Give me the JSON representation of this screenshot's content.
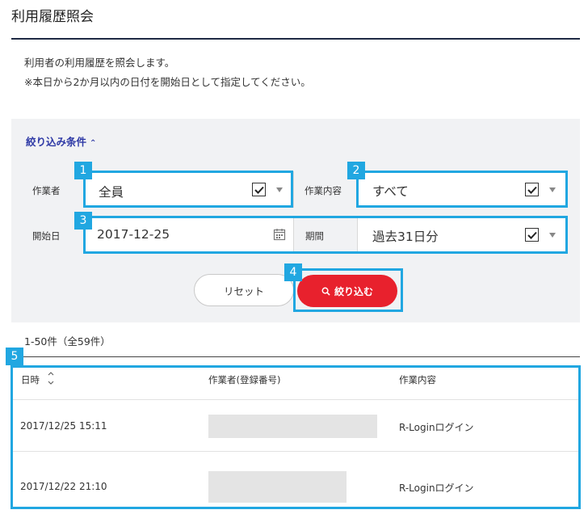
{
  "page": {
    "title": "利用履歴照会",
    "description_line1": "利用者の利用履歴を照会します。",
    "description_line2": "※本日から2か月以内の日付を開始日として指定してください。"
  },
  "filter": {
    "toggle_label": "絞り込み条件",
    "toggle_icon": "chevron-up-icon",
    "worker_label": "作業者",
    "worker_value": "全員",
    "work_content_label": "作業内容",
    "work_content_value": "すべて",
    "start_date_label": "開始日",
    "start_date_value": "2017-12-25",
    "period_label": "期間",
    "period_value": "過去31日分",
    "reset_label": "リセット",
    "submit_label": "絞り込む"
  },
  "annotations": {
    "badges": [
      "1",
      "2",
      "3",
      "4",
      "5"
    ],
    "highlight_color": "#21a7e1"
  },
  "results": {
    "count_text": "1-50件（全59件）",
    "columns": [
      "日時",
      "作業者(登録番号)",
      "作業内容"
    ],
    "rows": [
      {
        "datetime": "2017/12/25 15:11",
        "worker": "",
        "action": "R-Loginログイン"
      },
      {
        "datetime": "2017/12/22 21:10",
        "worker": "",
        "action": "R-Loginログイン"
      }
    ]
  },
  "colors": {
    "accent_red": "#e8212d",
    "link_blue": "#2f3aa6",
    "panel_bg": "#f1f2f4"
  }
}
